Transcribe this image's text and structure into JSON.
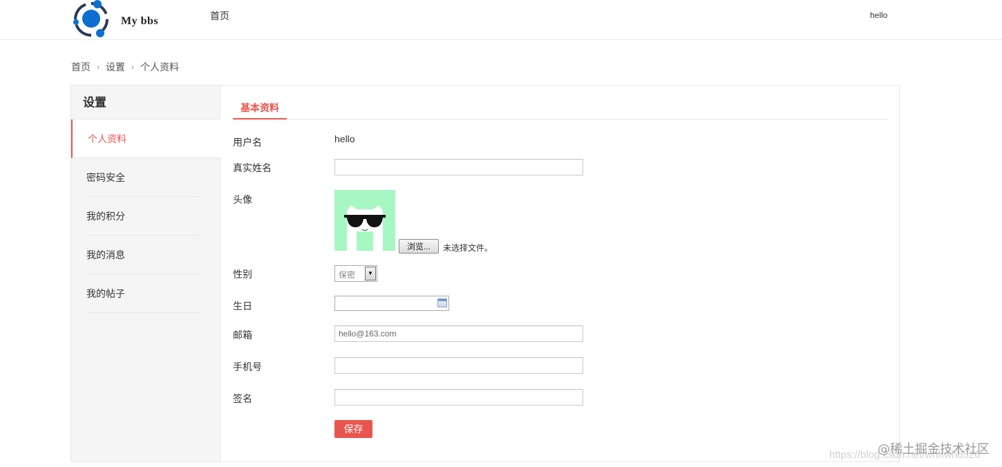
{
  "header": {
    "brand": "My bbs",
    "nav_home": "首页",
    "user": "hello"
  },
  "breadcrumb": [
    "首页",
    "设置",
    "个人资料"
  ],
  "sidebar": {
    "title": "设置",
    "items": [
      {
        "label": "个人资料",
        "active": true
      },
      {
        "label": "密码安全"
      },
      {
        "label": "我的积分"
      },
      {
        "label": "我的消息"
      },
      {
        "label": "我的帖子"
      }
    ]
  },
  "tab": {
    "label": "基本资料"
  },
  "form": {
    "username_label": "用户名",
    "username_value": "hello",
    "realname_label": "真实姓名",
    "realname_value": "",
    "avatar_label": "头像",
    "browse_label": "浏览...",
    "file_status": "未选择文件。",
    "gender_label": "性别",
    "gender_value": "保密",
    "birthday_label": "生日",
    "email_label": "邮箱",
    "email_value": "hello@163.com",
    "phone_label": "手机号",
    "phone_value": "",
    "signature_label": "签名",
    "signature_value": "",
    "save_label": "保存"
  },
  "colors": {
    "accent": "#e8554e",
    "avatar_bg": "#a6f7c1",
    "logo_blue": "#0d6fd0"
  },
  "watermark": "@稀土掘金技术社区",
  "url_watermark": "https://blog.csdn.net/whhwhd526"
}
